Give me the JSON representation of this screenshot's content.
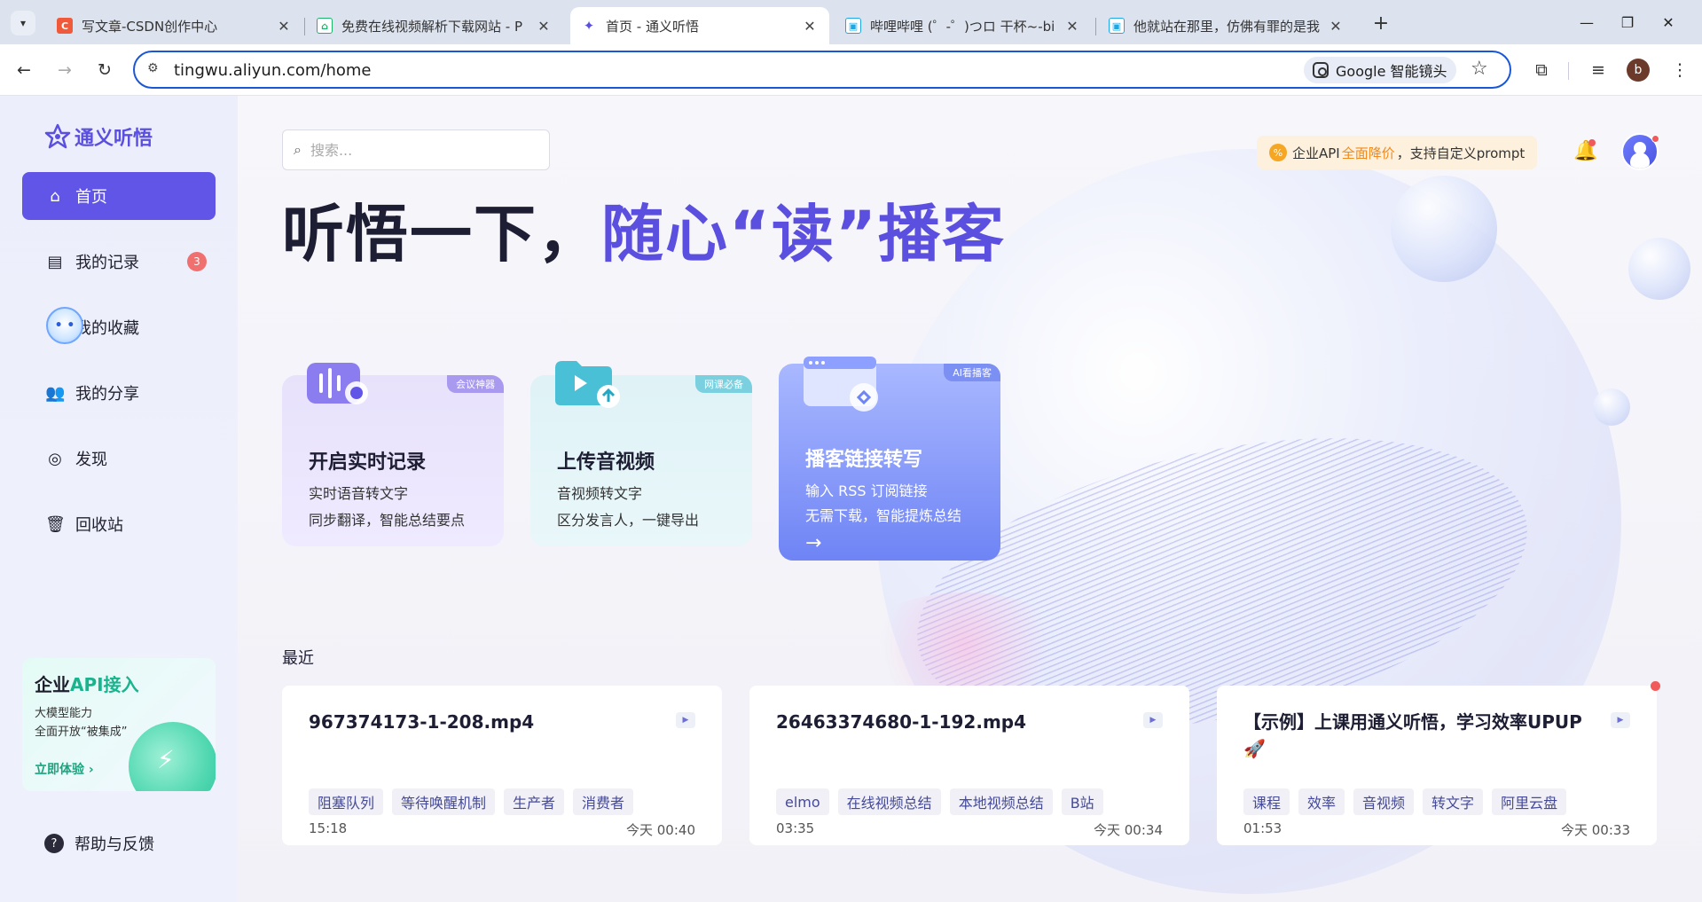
{
  "browser": {
    "tabs": [
      {
        "title": "写文章-CSDN创作中心",
        "favicon_color": "#f05a3a",
        "favicon_char": "C"
      },
      {
        "title": "免费在线视频解析下载网站 - P",
        "favicon_color": "#1db36a",
        "favicon_char": "⌂"
      },
      {
        "title": "首页 - 通义听悟",
        "favicon_color": "#5b4fe0",
        "favicon_char": "✦"
      },
      {
        "title": "哔哩哔哩 (゜-゜)つロ 干杯~-bi",
        "favicon_color": "#1ea7e1",
        "favicon_char": "▣"
      },
      {
        "title": "他就站在那里，仿佛有罪的是我",
        "favicon_color": "#1ea7e1",
        "favicon_char": "▣"
      }
    ],
    "url": "tingwu.aliyun.com/home",
    "lens_label": "Google 智能镜头",
    "profile_initial": "b"
  },
  "app": {
    "logo_text": "通义听悟",
    "nav": [
      {
        "label": "首页",
        "icon": "home-icon",
        "active": true
      },
      {
        "label": "我的记录",
        "icon": "document-icon",
        "badge": "3"
      },
      {
        "label": "我的收藏",
        "icon": "star-icon"
      },
      {
        "label": "我的分享",
        "icon": "users-icon"
      },
      {
        "label": "发现",
        "icon": "signal-icon"
      },
      {
        "label": "回收站",
        "icon": "trash-icon"
      }
    ],
    "api_card": {
      "title_prefix": "企业",
      "title_highlight": "API接入",
      "desc_line1": "大模型能力",
      "desc_line2": "全面开放“被集成”",
      "link": "立即体验"
    },
    "help_label": "帮助与反馈",
    "search": {
      "placeholder": "搜索..."
    },
    "promo": {
      "prefix": "企业API",
      "highlight": "全面降价",
      "suffix": "，支持自定义prompt"
    },
    "hero": {
      "part1": "听悟一下，",
      "part2": "随心“读”播客"
    },
    "features": [
      {
        "tag": "会议神器",
        "title": "开启实时记录",
        "line1": "实时语音转文字",
        "line2": "同步翻译，智能总结要点"
      },
      {
        "tag": "网课必备",
        "title": "上传音视频",
        "line1": "音视频转文字",
        "line2": "区分发言人，一键导出"
      },
      {
        "tag": "AI看播客",
        "title": "播客链接转写",
        "line1": "输入 RSS 订阅链接",
        "line2": "无需下载，智能提炼总结",
        "arrow": "→"
      }
    ],
    "recent_label": "最近",
    "recent": [
      {
        "title": "967374173-1-208.mp4",
        "tags": [
          "阻塞队列",
          "等待唤醒机制",
          "生产者",
          "消费者"
        ],
        "duration": "15:18",
        "time": "今天 00:40"
      },
      {
        "title": "26463374680-1-192.mp4",
        "tags": [
          "elmo",
          "在线视频总结",
          "本地视频总结",
          "B站"
        ],
        "duration": "03:35",
        "time": "今天 00:34"
      },
      {
        "title": "【示例】上课用通义听悟，学习效率UPUP 🚀",
        "tags": [
          "课程",
          "效率",
          "音视频",
          "转文字",
          "阿里云盘"
        ],
        "duration": "01:53",
        "time": "今天 00:33"
      }
    ]
  }
}
